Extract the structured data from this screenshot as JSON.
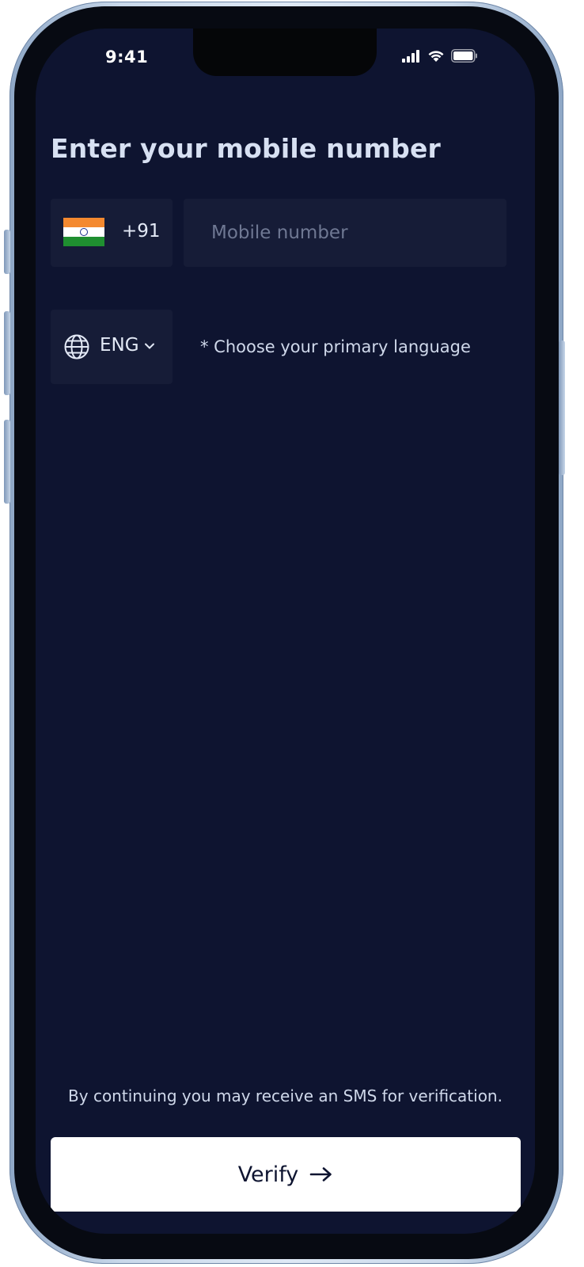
{
  "status_bar": {
    "time": "9:41",
    "icons": [
      "signal-icon",
      "wifi-icon",
      "battery-icon"
    ]
  },
  "page": {
    "title": "Enter your mobile number"
  },
  "phone": {
    "country_flag": "india-flag-icon",
    "country_code": "+91",
    "placeholder": "Mobile number",
    "value": ""
  },
  "language": {
    "icon": "globe-icon",
    "selected": "ENG",
    "hint": "* Choose your primary language"
  },
  "footer": {
    "note": "By continuing you may receive an SMS for verification.",
    "verify_label": "Verify"
  },
  "colors": {
    "background": "#0e1430",
    "field": "#161c37",
    "title": "#d7e0f2",
    "button": "#ffffff"
  }
}
